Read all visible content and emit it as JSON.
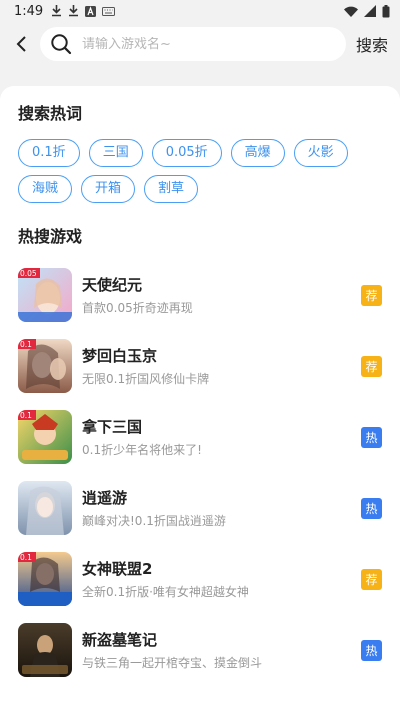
{
  "status_bar": {
    "time": "1:49",
    "icons": [
      "download-icon",
      "download-icon",
      "a-icon",
      "keyboard-icon"
    ],
    "right_icons": [
      "wifi-icon",
      "signal-icon",
      "battery-icon"
    ]
  },
  "search": {
    "placeholder": "请输入游戏名~",
    "value": "",
    "button_label": "搜索"
  },
  "hot_words": {
    "title": "搜索热词",
    "tags": [
      "0.1折",
      "三国",
      "0.05折",
      "高爆",
      "火影",
      "海贼",
      "开箱",
      "割草"
    ]
  },
  "hot_games": {
    "title": "热搜游戏",
    "items": [
      {
        "name": "天使纪元",
        "desc": "首款0.05折奇迹再现",
        "badge": "荐",
        "badge_type": "rec",
        "icon": "angel-game-icon",
        "icon_label": "0.05",
        "accent": "#f27cb0"
      },
      {
        "name": "梦回白玉京",
        "desc": "无限0.1折国风修仙卡牌",
        "badge": "荐",
        "badge_type": "rec",
        "icon": "fantasy-game-icon",
        "icon_label": "0.1",
        "accent": "#d9a27a"
      },
      {
        "name": "拿下三国",
        "desc": "0.1折少年名将他来了!",
        "badge": "热",
        "badge_type": "hot",
        "icon": "threekingdoms-game-icon",
        "icon_label": "0.1",
        "accent": "#e8b040"
      },
      {
        "name": "逍遥游",
        "desc": "巅峰对决!0.1折国战逍遥游",
        "badge": "热",
        "badge_type": "hot",
        "icon": "xiaoyao-game-icon",
        "icon_label": "",
        "accent": "#b9c6d6"
      },
      {
        "name": "女神联盟2",
        "desc": "全新0.1折版·唯有女神超越女神",
        "badge": "荐",
        "badge_type": "rec",
        "icon": "goddess-game-icon",
        "icon_label": "0.1",
        "accent": "#6e8ec7"
      },
      {
        "name": "新盗墓笔记",
        "desc": "与铁三角一起开棺夺宝、摸金倒斗",
        "badge": "热",
        "badge_type": "hot",
        "icon": "tombraider-game-icon",
        "icon_label": "",
        "accent": "#6a5a3c"
      }
    ]
  }
}
